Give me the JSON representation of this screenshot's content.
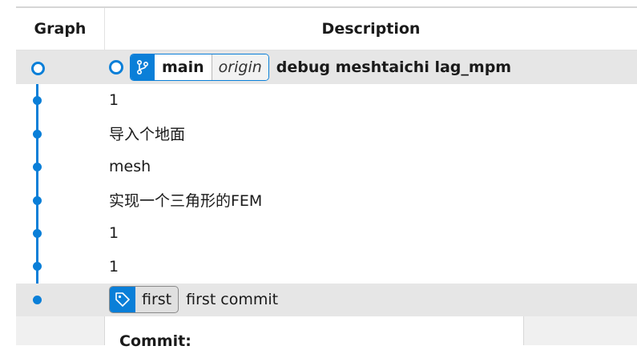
{
  "header": {
    "graph_label": "Graph",
    "description_label": "Description"
  },
  "head_row": {
    "branch": "main",
    "remote": "origin",
    "message": "debug meshtaichi lag_mpm"
  },
  "commits": [
    {
      "message": "1"
    },
    {
      "message": "导入个地面"
    },
    {
      "message": "mesh"
    },
    {
      "message": "实现一个三角形的FEM"
    },
    {
      "message": "1"
    },
    {
      "message": "1"
    }
  ],
  "tail_row": {
    "tag": "first",
    "message": "first commit"
  },
  "details": {
    "commit_label": "Commit:"
  },
  "icons": {
    "branch": "git-branch-icon",
    "tag": "tag-icon"
  },
  "colors": {
    "accent": "#0a7fd8",
    "highlight_row": "#e6e6e6"
  }
}
